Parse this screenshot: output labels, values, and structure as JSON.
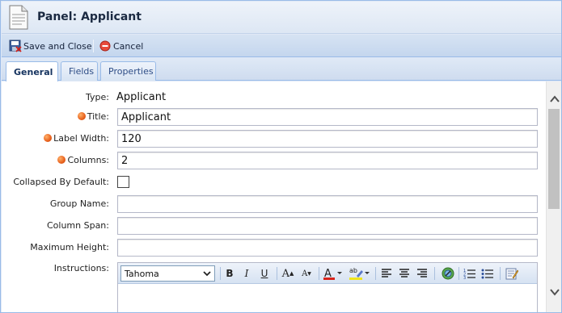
{
  "window": {
    "title": "Panel: Applicant",
    "icon": "document-icon"
  },
  "toolbar": {
    "save_close_label": "Save and Close",
    "save_close_icon": "save-close-icon",
    "cancel_label": "Cancel",
    "cancel_icon": "cancel-icon"
  },
  "tabs": [
    {
      "label": "General",
      "active": true
    },
    {
      "label": "Fields",
      "active": false
    },
    {
      "label": "Properties",
      "active": false
    }
  ],
  "form": {
    "type": {
      "label": "Type:",
      "value": "Applicant"
    },
    "title": {
      "label": "Title:",
      "value": "Applicant",
      "required": true
    },
    "label_width": {
      "label": "Label Width:",
      "value": "120",
      "required": true
    },
    "columns": {
      "label": "Columns:",
      "value": "2",
      "required": true
    },
    "collapsed_by_default": {
      "label": "Collapsed By Default:",
      "checked": false
    },
    "group_name": {
      "label": "Group Name:",
      "value": ""
    },
    "column_span": {
      "label": "Column Span:",
      "value": ""
    },
    "maximum_height": {
      "label": "Maximum Height:",
      "value": ""
    },
    "instructions": {
      "label": "Instructions:",
      "value": ""
    }
  },
  "editor": {
    "font": "Tahoma",
    "buttons": [
      "bold-icon",
      "italic-icon",
      "underline-icon",
      "grow-font-icon",
      "shrink-font-icon",
      "font-color-icon",
      "highlight-icon",
      "align-left-icon",
      "align-center-icon",
      "align-right-icon",
      "link-icon",
      "ordered-list-icon",
      "unordered-list-icon",
      "source-edit-icon"
    ]
  },
  "colors": {
    "accent": "#99bbe8",
    "required_dot": "#e8601c",
    "panel_bg": "#dfe8f6"
  }
}
